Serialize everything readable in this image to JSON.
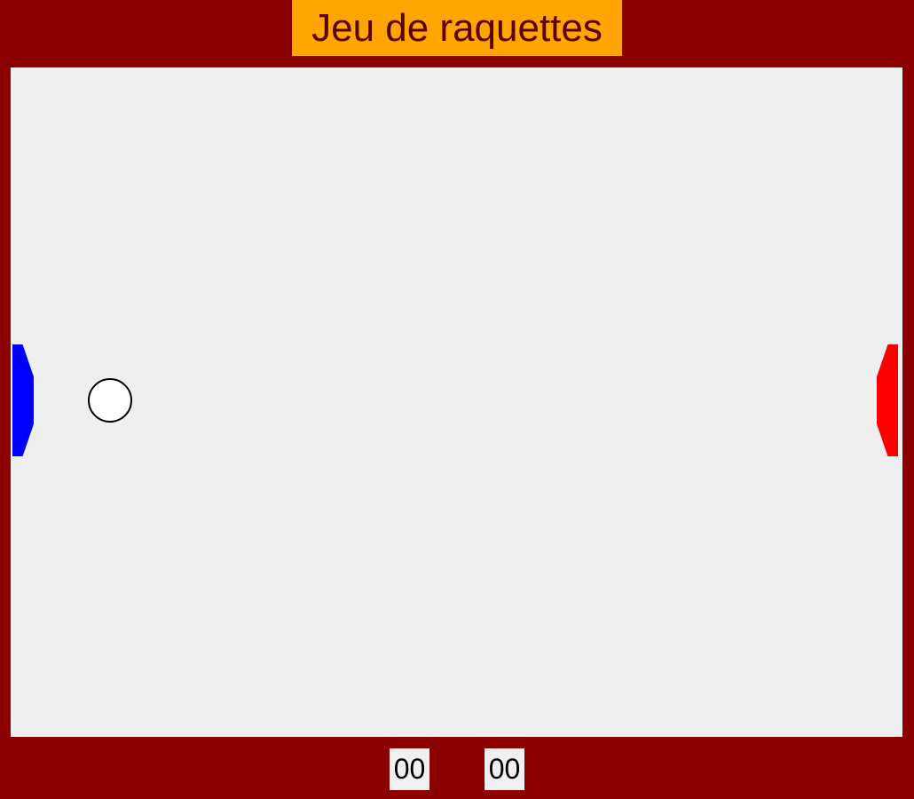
{
  "title": "Jeu de raquettes",
  "colors": {
    "frame": "#8b0000",
    "title_background": "#ffa500",
    "title_text": "#5a0000",
    "field": "#efefef",
    "left_paddle": "#0000ff",
    "right_paddle": "#ff0000",
    "ball_fill": "#ffffff",
    "ball_stroke": "#000000",
    "score_background": "#f0f0f0"
  },
  "scores": {
    "left": "00",
    "right": "00"
  }
}
